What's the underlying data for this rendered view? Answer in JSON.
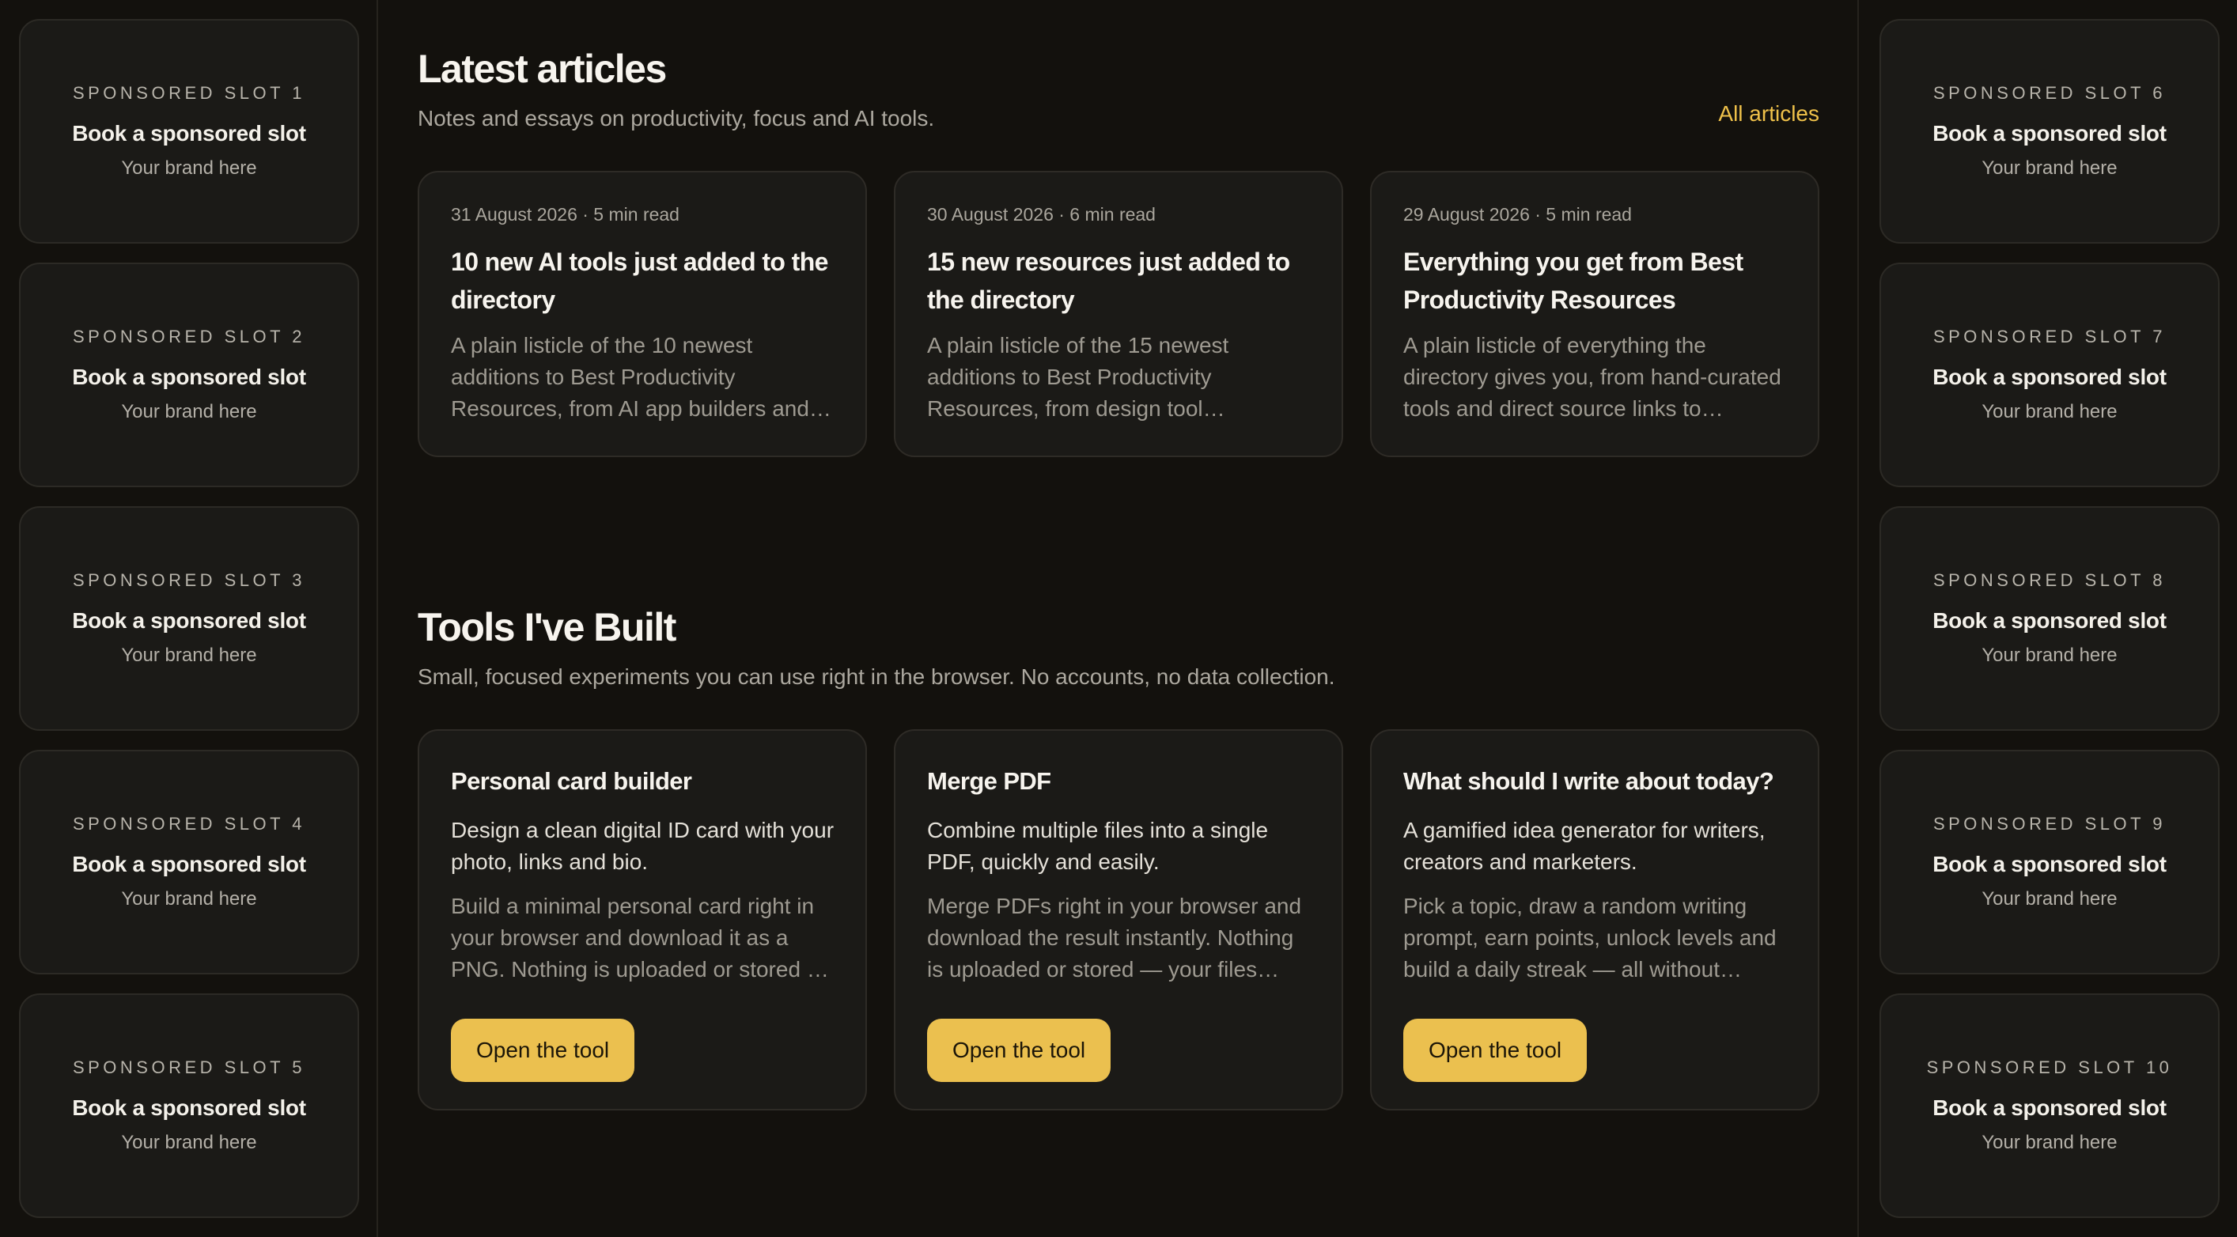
{
  "colors": {
    "background": "#13110d",
    "card": "#1b1a17",
    "accent": "#ebc04f",
    "link": "#efc14a"
  },
  "sponsored_left": [
    {
      "label": "SPONSORED SLOT 1",
      "title": "Book a sponsored slot",
      "sub": "Your brand here"
    },
    {
      "label": "SPONSORED SLOT 2",
      "title": "Book a sponsored slot",
      "sub": "Your brand here"
    },
    {
      "label": "SPONSORED SLOT 3",
      "title": "Book a sponsored slot",
      "sub": "Your brand here"
    },
    {
      "label": "SPONSORED SLOT 4",
      "title": "Book a sponsored slot",
      "sub": "Your brand here"
    },
    {
      "label": "SPONSORED SLOT 5",
      "title": "Book a sponsored slot",
      "sub": "Your brand here"
    }
  ],
  "sponsored_right": [
    {
      "label": "SPONSORED SLOT 6",
      "title": "Book a sponsored slot",
      "sub": "Your brand here"
    },
    {
      "label": "SPONSORED SLOT 7",
      "title": "Book a sponsored slot",
      "sub": "Your brand here"
    },
    {
      "label": "SPONSORED SLOT 8",
      "title": "Book a sponsored slot",
      "sub": "Your brand here"
    },
    {
      "label": "SPONSORED SLOT 9",
      "title": "Book a sponsored slot",
      "sub": "Your brand here"
    },
    {
      "label": "SPONSORED SLOT 10",
      "title": "Book a sponsored slot",
      "sub": "Your brand here"
    }
  ],
  "articles": {
    "title": "Latest articles",
    "subtitle": "Notes and essays on productivity, focus and AI tools.",
    "all_link": "All articles",
    "items": [
      {
        "meta": "31 August 2026 · 5 min read",
        "title": "10 new AI tools just added to the directory",
        "excerpt": "A plain listicle of the 10 newest additions to Best Productivity Resources, from AI app builders and agent coworkers to..."
      },
      {
        "meta": "30 August 2026 · 6 min read",
        "title": "15 new resources just added to the directory",
        "excerpt": "A plain listicle of the 15 newest additions to Best Productivity Resources, from design tool directories and UI inspiratio..."
      },
      {
        "meta": "29 August 2026 · 5 min read",
        "title": "Everything you get from Best Productivity Resources",
        "excerpt": "A plain listicle of everything the directory gives you, from hand-curated tools and direct source links to articles,..."
      }
    ]
  },
  "tools": {
    "title": "Tools I've Built",
    "subtitle": "Small, focused experiments you can use right in the browser. No accounts, no data collection.",
    "items": [
      {
        "title": "Personal card builder",
        "tagline": "Design a clean digital ID card with your photo, links and bio.",
        "description": "Build a minimal personal card right in your browser and download it as a PNG. Nothing is uploaded or stored — your...",
        "button": "Open the tool"
      },
      {
        "title": "Merge PDF",
        "tagline": "Combine multiple files into a single PDF, quickly and easily.",
        "description": "Merge PDFs right in your browser and download the result instantly. Nothing is uploaded or stored — your files never...",
        "button": "Open the tool"
      },
      {
        "title": "What should I write about today?",
        "tagline": "A gamified idea generator for writers, creators and marketers.",
        "description": "Pick a topic, draw a random writing prompt, earn points, unlock levels and build a daily streak — all without signin...",
        "button": "Open the tool"
      }
    ]
  }
}
